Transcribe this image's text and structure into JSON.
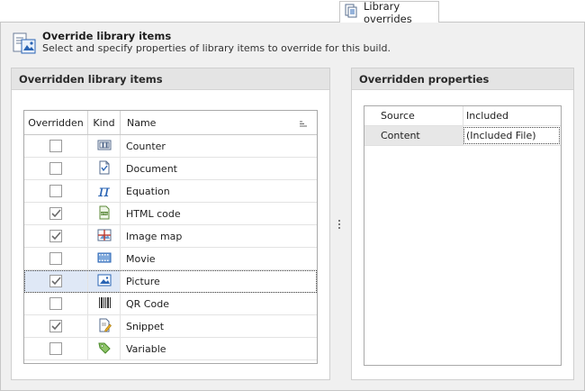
{
  "tab": {
    "label": "Library overrides",
    "icon": "library-overrides-icon"
  },
  "header": {
    "title": "Override library items",
    "description": "Select and specify properties of library items to override for this build.",
    "icon": "override-items-icon"
  },
  "left_group": {
    "title": "Overridden library items",
    "columns": {
      "overridden": "Overridden",
      "kind": "Kind",
      "name": "Name"
    },
    "rows": [
      {
        "name": "Counter",
        "checked": false,
        "icon": "counter-icon"
      },
      {
        "name": "Document",
        "checked": false,
        "icon": "document-icon"
      },
      {
        "name": "Equation",
        "checked": false,
        "icon": "equation-pi-icon"
      },
      {
        "name": "HTML code",
        "checked": true,
        "icon": "html-code-icon"
      },
      {
        "name": "Image map",
        "checked": true,
        "icon": "image-map-icon"
      },
      {
        "name": "Movie",
        "checked": false,
        "icon": "movie-icon"
      },
      {
        "name": "Picture",
        "checked": true,
        "icon": "picture-icon",
        "selected": true
      },
      {
        "name": "QR Code",
        "checked": false,
        "icon": "qr-code-icon"
      },
      {
        "name": "Snippet",
        "checked": true,
        "icon": "snippet-icon"
      },
      {
        "name": "Variable",
        "checked": false,
        "icon": "variable-tag-icon"
      }
    ]
  },
  "right_group": {
    "title": "Overridden properties",
    "properties": [
      {
        "name": "Source",
        "value": "Included"
      },
      {
        "name": "Content",
        "value": "(Included File)",
        "active": true
      }
    ]
  },
  "colors": {
    "selection": "#dfe8f6",
    "panel": "#f0f0f0",
    "group_header": "#e4e4e4",
    "accent_blue": "#2a64b4"
  }
}
